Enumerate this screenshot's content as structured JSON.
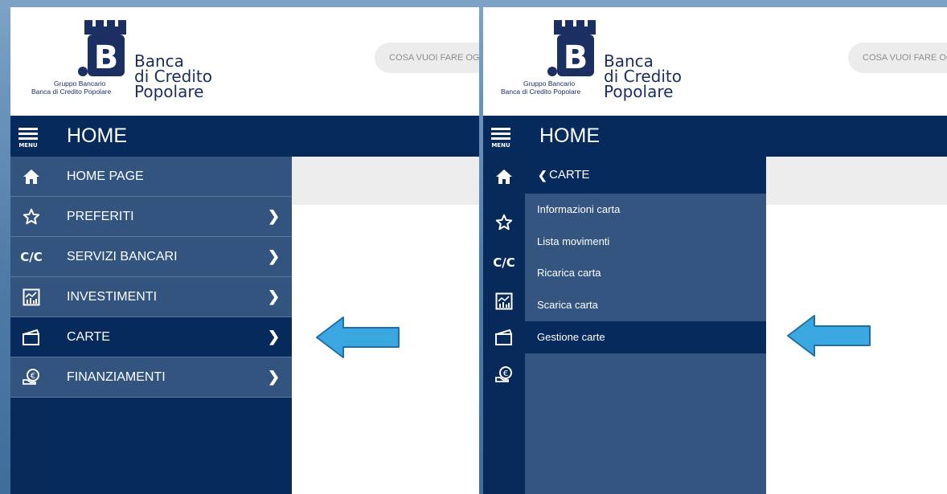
{
  "brand": {
    "name_lines": [
      "Banca",
      "di Credito",
      "Popolare"
    ],
    "group_lines": [
      "Gruppo Bancario",
      "Banca di Credito Popolare"
    ],
    "color": "#1c2f63"
  },
  "search": {
    "placeholder": "COSA VUOI FARE OGGI?"
  },
  "menu_button": {
    "label": "MENU"
  },
  "page_title": "HOME",
  "left_panel": {
    "items": [
      {
        "label": "HOME PAGE",
        "icon": "home-icon",
        "chevron": ""
      },
      {
        "label": "PREFERITI",
        "icon": "star-icon",
        "chevron": "❯"
      },
      {
        "label": "SERVIZI BANCARI",
        "icon": "cc-icon",
        "chevron": "❯"
      },
      {
        "label": "INVESTIMENTI",
        "icon": "chart-icon",
        "chevron": "❯"
      },
      {
        "label": "CARTE",
        "icon": "card-icon",
        "chevron": "❯"
      },
      {
        "label": "FINANZIAMENTI",
        "icon": "financing-icon",
        "chevron": "❯"
      }
    ]
  },
  "right_panel": {
    "submenu_title": "CARTE",
    "back_icon": "chevron-left-icon",
    "items": [
      {
        "label": "Informazioni carta"
      },
      {
        "label": "Lista movimenti"
      },
      {
        "label": "Ricarica carta"
      },
      {
        "label": "Scarica carta"
      },
      {
        "label": "Gestione carte"
      }
    ]
  },
  "icon_text": {
    "cc": "C/C"
  },
  "colors": {
    "navy": "#072a5c",
    "menu_blue": "#33547e",
    "arrow": "#3aa7e0",
    "background": "#5b86b0"
  }
}
